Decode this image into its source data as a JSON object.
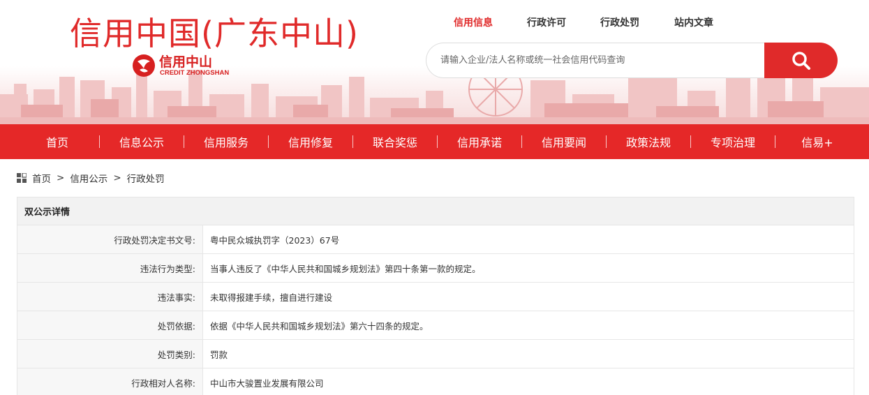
{
  "header": {
    "site_title": "信用中国(广东中山)",
    "logo_cn": "信用中山",
    "logo_en": "CREDIT ZHONGSHAN",
    "brand_color": "#e02a2a"
  },
  "topnav": {
    "items": [
      "信用信息",
      "行政许可",
      "行政处罚",
      "站内文章"
    ],
    "active": "信用信息"
  },
  "search": {
    "placeholder": "请输入企业/法人名称或统一社会信用代码查询",
    "icon": "search-icon"
  },
  "mainnav": {
    "items": [
      "首页",
      "信息公示",
      "信用服务",
      "信用修复",
      "联合奖惩",
      "信用承诺",
      "信用要闻",
      "政策法规",
      "专项治理",
      "信易+"
    ]
  },
  "breadcrumb": {
    "icon": "grid-icon",
    "items": [
      "首页",
      "信用公示",
      "行政处罚"
    ],
    "separator": ">"
  },
  "detail": {
    "title": "双公示详情",
    "rows": [
      {
        "label": "行政处罚决定书文号:",
        "value": "粤中民众城执罚字（2023）67号"
      },
      {
        "label": "违法行为类型:",
        "value": "当事人违反了《中华人民共和国城乡规划法》第四十条第一款的规定。"
      },
      {
        "label": "违法事实:",
        "value": "未取得报建手续，擅自进行建设"
      },
      {
        "label": "处罚依据:",
        "value": "依据《中华人民共和国城乡规划法》第六十四条的规定。"
      },
      {
        "label": "处罚类别:",
        "value": "罚款"
      },
      {
        "label": "行政相对人名称:",
        "value": "中山市大骏置业发展有限公司"
      }
    ]
  }
}
